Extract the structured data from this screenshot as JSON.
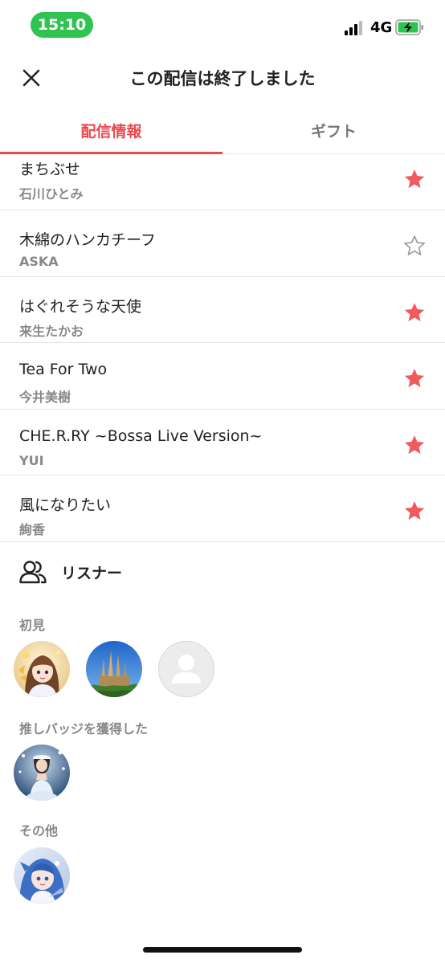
{
  "status_bar": {
    "time": "15:10",
    "network": "4G"
  },
  "header": {
    "title": "この配信は終了しました"
  },
  "tabs": [
    {
      "label": "配信情報",
      "active": true
    },
    {
      "label": "ギフト",
      "active": false
    }
  ],
  "songs": [
    {
      "title": "まちぶせ",
      "artist": "石川ひとみ",
      "favorited": true
    },
    {
      "title": "木綿のハンカチーフ",
      "artist": "ASKA",
      "favorited": false
    },
    {
      "title": "はぐれそうな天使",
      "artist": "来生たかお",
      "favorited": true
    },
    {
      "title": "Tea For Two",
      "artist": "今井美樹",
      "favorited": true
    },
    {
      "title": "CHE.R.RY ~Bossa Live Version~",
      "artist": "YUI",
      "favorited": true
    },
    {
      "title": "風になりたい",
      "artist": "絢香",
      "favorited": true
    }
  ],
  "listeners": {
    "title": "リスナー",
    "groups": [
      {
        "label": "初見",
        "avatars": [
          "hana-avatar",
          "cathedral-avatar",
          "default-avatar"
        ]
      },
      {
        "label": "推しバッジを獲得した",
        "avatars": [
          "dress-avatar"
        ]
      },
      {
        "label": "その他",
        "avatars": [
          "anime-avatar"
        ]
      }
    ]
  },
  "colors": {
    "accent": "#ea4a4f",
    "star_filled": "#ef5a5f",
    "status_green": "#2fc450",
    "muted_text": "#888888"
  }
}
